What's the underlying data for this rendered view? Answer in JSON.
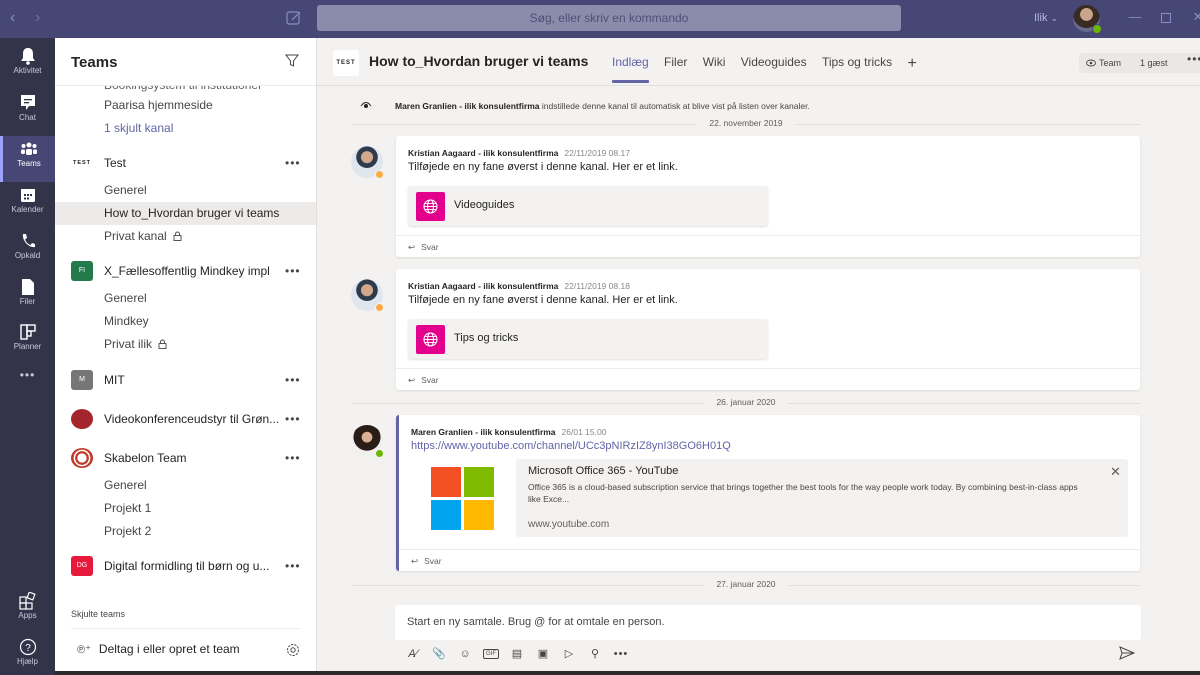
{
  "titlebar": {
    "back_icon": "chevron-left",
    "forward_icon": "chevron-right",
    "search_placeholder": "Søg, eller skriv en kommando",
    "tenant": "Ilik",
    "window_controls": [
      "minimize",
      "maximize",
      "close"
    ]
  },
  "appbar": {
    "items": [
      {
        "label": "Aktivitet",
        "icon": "bell-icon"
      },
      {
        "label": "Chat",
        "icon": "chat-icon"
      },
      {
        "label": "Teams",
        "icon": "teams-icon",
        "active": true
      },
      {
        "label": "Kalender",
        "icon": "calendar-icon"
      },
      {
        "label": "Opkald",
        "icon": "phone-icon"
      },
      {
        "label": "Filer",
        "icon": "file-icon"
      },
      {
        "label": "Planner",
        "icon": "planner-icon"
      }
    ],
    "more": "•••",
    "apps_label": "Apps",
    "help_label": "Hjælp"
  },
  "teams_pane": {
    "title": "Teams",
    "clipped_item": "Bookingsystem til institutioner",
    "top_channels": [
      "Paarisa hjemmeside"
    ],
    "hidden_channels_link": "1 skjult kanal",
    "teams": [
      {
        "name": "Test",
        "icon_text": "TEST",
        "icon_color": "#ffffff",
        "channels": [
          "Generel",
          "How to_Hvordan bruger vi teams",
          "Privat kanal"
        ],
        "selected_channel": "How to_Hvordan bruger vi teams",
        "private_channels": [
          "Privat kanal"
        ]
      },
      {
        "name": "X_Fællesoffentlig Mindkey impl",
        "icon_text": "FI",
        "icon_color": "#237b4b",
        "channels": [
          "Generel",
          "Mindkey",
          "Privat ilik"
        ],
        "private_channels": [
          "Privat ilik"
        ]
      },
      {
        "name": "MIT",
        "icon_text": "M",
        "icon_color": "#767676",
        "channels": []
      },
      {
        "name": "Videokonferenceudstyr til Grøn...",
        "icon_text": "",
        "icon_color": "#a4262c",
        "channels": []
      },
      {
        "name": "Skabelon Team",
        "icon_text": "",
        "icon_color": "#c0392b",
        "channels": [
          "Generel",
          "Projekt 1",
          "Projekt 2"
        ]
      },
      {
        "name": "Digital formidling til børn og u...",
        "icon_text": "DG",
        "icon_color": "#e81a3b",
        "channels": []
      }
    ],
    "more_label": "•••",
    "hidden_teams_label": "Skjulte teams",
    "join_label": "Deltag i eller opret et team"
  },
  "channel_header": {
    "team_logo_text": "TEST",
    "channel_name": "How to_Hvordan bruger vi teams",
    "tabs": [
      {
        "label": "Indlæg",
        "active": true
      },
      {
        "label": "Filer"
      },
      {
        "label": "Wiki"
      },
      {
        "label": "Videoguides"
      },
      {
        "label": "Tips og tricks"
      }
    ],
    "add_tab": "+",
    "team_button": "Team",
    "guest_button": "1 gæst",
    "more": "•••"
  },
  "messages": {
    "system": {
      "author": "Maren Granlien - ilik konsulentfirma",
      "text": "indstillede denne kanal til automatisk at blive vist på listen over kanaler."
    },
    "date_1": "22. november 2019",
    "post_1": {
      "author": "Kristian Aagaard - ilik konsulentfirma",
      "time": "22/11/2019 08.17",
      "text": "Tilføjede en ny fane øverst i denne kanal. Her er et link.",
      "card_label": "Videoguides",
      "presence": "away",
      "reply": "Svar"
    },
    "post_2": {
      "author": "Kristian Aagaard - ilik konsulentfirma",
      "time": "22/11/2019 08.18",
      "text": "Tilføjede en ny fane øverst i denne kanal. Her er et link.",
      "card_label": "Tips og tricks",
      "presence": "away",
      "reply": "Svar"
    },
    "date_2": "26. januar 2020",
    "post_3": {
      "author": "Maren Granlien - ilik konsulentfirma",
      "time": "26/01 15.00",
      "link": "https://www.youtube.com/channel/UCc3pNIRzIZ8ynI38GO6H01Q",
      "preview_title": "Microsoft Office 365 - YouTube",
      "preview_description": "Office 365 is a cloud-based subscription service that brings together the best tools for the way people work today. By combining best-in-class apps like Exce...",
      "preview_url": "www.youtube.com",
      "presence": "available",
      "reply": "Svar"
    },
    "date_3": "27. januar 2020"
  },
  "compose": {
    "placeholder": "Start en ny samtale. Brug @ for at omtale en person.",
    "tools": [
      "format-icon",
      "attach-icon",
      "emoji-icon",
      "gif-icon",
      "sticker-icon",
      "meet-now-icon",
      "stream-icon",
      "praise-icon",
      "more-icon"
    ]
  },
  "colors": {
    "accent": "#6264a7",
    "titlebar": "#464775",
    "appbar": "#33344a",
    "tab_link_icon": "#e3008c",
    "ms_logo": [
      "#f25022",
      "#7fba00",
      "#00a4ef",
      "#ffb900"
    ]
  }
}
